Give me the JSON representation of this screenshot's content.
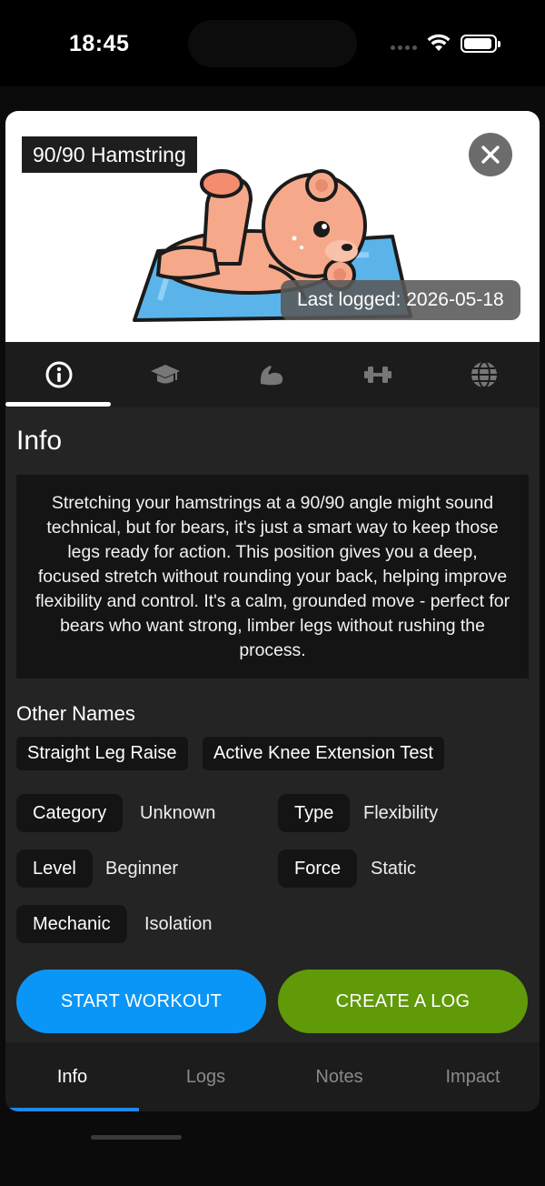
{
  "status_bar": {
    "time": "18:45"
  },
  "exercise": {
    "title": "90/90 Hamstring",
    "last_logged": "Last logged: 2026-05-18"
  },
  "tabs": [
    {
      "icon": "info-icon",
      "active": true
    },
    {
      "icon": "graduation-cap-icon",
      "active": false
    },
    {
      "icon": "flexed-bicep-icon",
      "active": false
    },
    {
      "icon": "dumbbell-icon",
      "active": false
    },
    {
      "icon": "globe-icon",
      "active": false
    }
  ],
  "info": {
    "heading": "Info",
    "description": "Stretching your hamstrings at a 90/90 angle might sound technical, but for bears, it's just a smart way to keep those legs ready for action. This position gives you a deep, focused stretch without rounding your back, helping improve flexibility and control. It's a calm, grounded move - perfect for bears who want strong, limber legs without rushing the process.",
    "other_names_heading": "Other Names",
    "other_names": [
      "Straight Leg Raise",
      "Active Knee Extension Test"
    ],
    "attributes": {
      "category": {
        "label": "Category",
        "value": "Unknown"
      },
      "type": {
        "label": "Type",
        "value": "Flexibility"
      },
      "level": {
        "label": "Level",
        "value": "Beginner"
      },
      "force": {
        "label": "Force",
        "value": "Static"
      },
      "mechanic": {
        "label": "Mechanic",
        "value": "Isolation"
      }
    }
  },
  "actions": {
    "start_workout": "START WORKOUT",
    "create_log": "CREATE A LOG"
  },
  "bottom_tabs": [
    {
      "label": "Info",
      "active": true
    },
    {
      "label": "Logs",
      "active": false
    },
    {
      "label": "Notes",
      "active": false
    },
    {
      "label": "Impact",
      "active": false
    }
  ],
  "colors": {
    "start_button": "#0a96f6",
    "log_button": "#609a08",
    "active_tab_indicator": "#1e88e5",
    "sheet_background": "#242424"
  }
}
